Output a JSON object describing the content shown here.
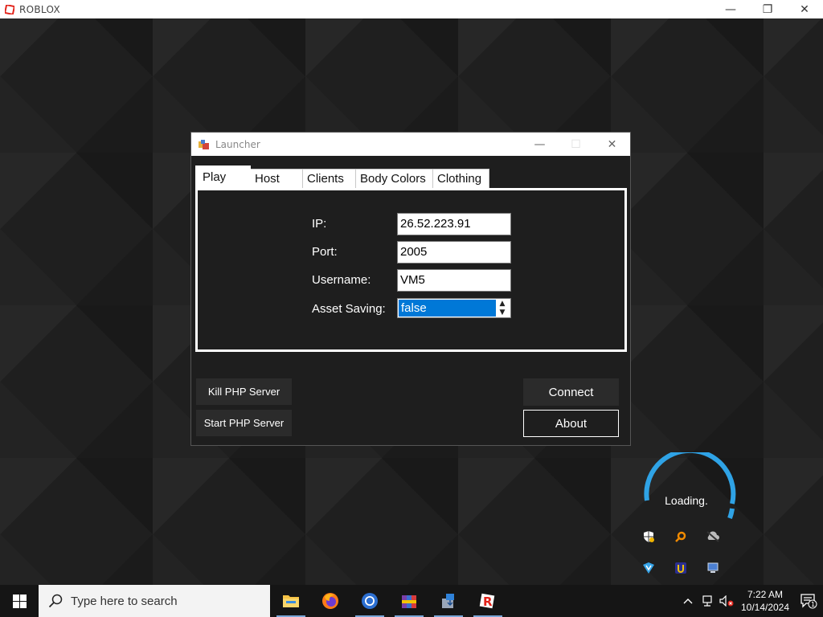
{
  "window": {
    "title": "ROBLOX",
    "controls": {
      "minimize": "—",
      "restore": "❐",
      "close": "✕"
    }
  },
  "launcher": {
    "title": "Launcher",
    "controls": {
      "minimize": "—",
      "maximize": "☐",
      "close": "✕"
    },
    "tabs": [
      {
        "label": "Play",
        "active": true
      },
      {
        "label": "Host",
        "active": false
      },
      {
        "label": "Clients",
        "active": false
      },
      {
        "label": "Body Colors",
        "active": false
      },
      {
        "label": "Clothing",
        "active": false
      }
    ],
    "form": {
      "ip_label": "IP:",
      "ip_value": "26.52.223.91",
      "port_label": "Port:",
      "port_value": "2005",
      "username_label": "Username:",
      "username_value": "VM5",
      "asset_saving_label": "Asset Saving:",
      "asset_saving_value": "false"
    },
    "buttons": {
      "kill_php": "Kill PHP Server",
      "start_php": "Start PHP Server",
      "connect": "Connect",
      "about": "About"
    }
  },
  "loading": {
    "text": "Loading."
  },
  "tray_icons": [
    "defender-warning-icon",
    "search-tool-icon",
    "cloud-off-icon",
    "vpn-icon",
    "u-app-icon",
    "network-monitor-icon"
  ],
  "taskbar": {
    "search_placeholder": "Type here to search",
    "apps": [
      "file-explorer-icon",
      "firefox-icon",
      "chrome-icon",
      "winrar-icon",
      "installer-icon",
      "roblox-icon"
    ],
    "clock_time": "7:22 AM",
    "clock_date": "10/14/2024",
    "notification_count": "1"
  },
  "colors": {
    "accent": "#0078d7",
    "loading_ring": "#2fa3e6",
    "roblox_red": "#e2231a"
  }
}
